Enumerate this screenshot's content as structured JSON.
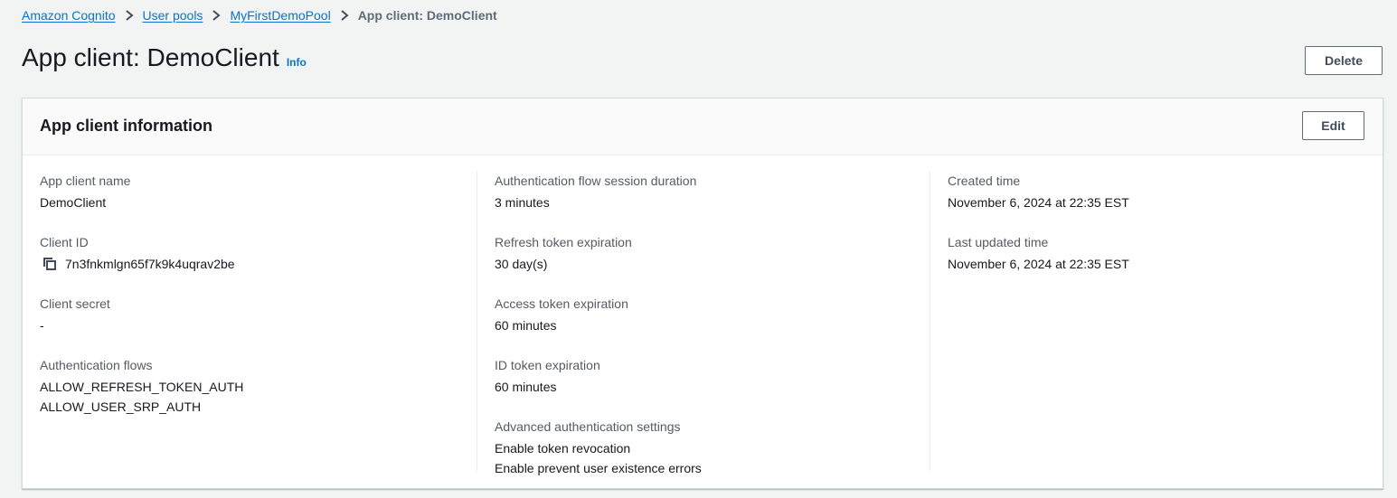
{
  "breadcrumb": {
    "items": [
      "Amazon Cognito",
      "User pools",
      "MyFirstDemoPool"
    ],
    "current": "App client: DemoClient"
  },
  "header": {
    "title": "App client: DemoClient",
    "info_label": "Info",
    "delete_label": "Delete"
  },
  "panel": {
    "title": "App client information",
    "edit_label": "Edit",
    "columns": [
      [
        {
          "label": "App client name",
          "values": [
            "DemoClient"
          ]
        },
        {
          "label": "Client ID",
          "values": [
            "7n3fnkmlgn65f7k9k4uqrav2be"
          ],
          "copy_icon": "copy-icon"
        },
        {
          "label": "Client secret",
          "values": [
            "-"
          ]
        },
        {
          "label": "Authentication flows",
          "values": [
            "ALLOW_REFRESH_TOKEN_AUTH",
            "ALLOW_USER_SRP_AUTH"
          ]
        }
      ],
      [
        {
          "label": "Authentication flow session duration",
          "values": [
            "3 minutes"
          ]
        },
        {
          "label": "Refresh token expiration",
          "values": [
            "30 day(s)"
          ]
        },
        {
          "label": "Access token expiration",
          "values": [
            "60 minutes"
          ]
        },
        {
          "label": "ID token expiration",
          "values": [
            "60 minutes"
          ]
        },
        {
          "label": "Advanced authentication settings",
          "values": [
            "Enable token revocation",
            "Enable prevent user existence errors"
          ]
        }
      ],
      [
        {
          "label": "Created time",
          "values": [
            "November 6, 2024 at 22:35 EST"
          ]
        },
        {
          "label": "Last updated time",
          "values": [
            "November 6, 2024 at 22:35 EST"
          ]
        }
      ]
    ]
  },
  "colors": {
    "link": "#0972d3",
    "background": "#f2f3f3",
    "panel_header": "#fafafa",
    "label_text": "#545b64",
    "value_text": "#16191f"
  },
  "icons": {
    "breadcrumb_separator": "chevron-right-icon",
    "copy": "copy-icon"
  }
}
